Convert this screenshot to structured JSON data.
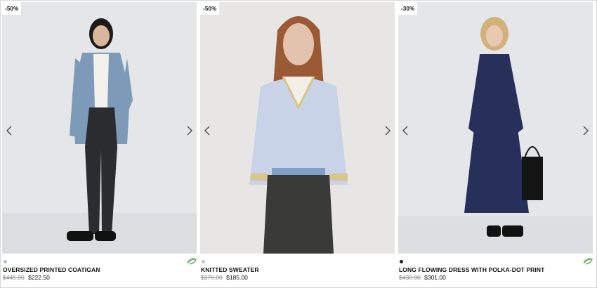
{
  "products": [
    {
      "badge": "-50%",
      "name": "OVERSIZED PRINTED COATIGAN",
      "old_price": "$445.00",
      "new_price": "$222.50",
      "swatch_color": "#a9bfdc",
      "eco_icon": "leaf-icon",
      "bg_color": "#e4e5e7"
    },
    {
      "badge": "-50%",
      "name": "KNITTED SWEATER",
      "old_price": "$370.00",
      "new_price": "$185.00",
      "swatch_color": "#b8c6e0",
      "bg_color": "#e7e5e3"
    },
    {
      "badge": "-30%",
      "name": "LONG FLOWING DRESS WITH POLKA-DOT PRINT",
      "old_price": "$430.00",
      "new_price": "$301.00",
      "swatch_color": "#1b1f2e",
      "eco_icon": "leaf-icon",
      "bg_color": "#e3e5e8"
    }
  ],
  "icons": {
    "prev": "chevron-left-icon",
    "next": "chevron-right-icon"
  }
}
